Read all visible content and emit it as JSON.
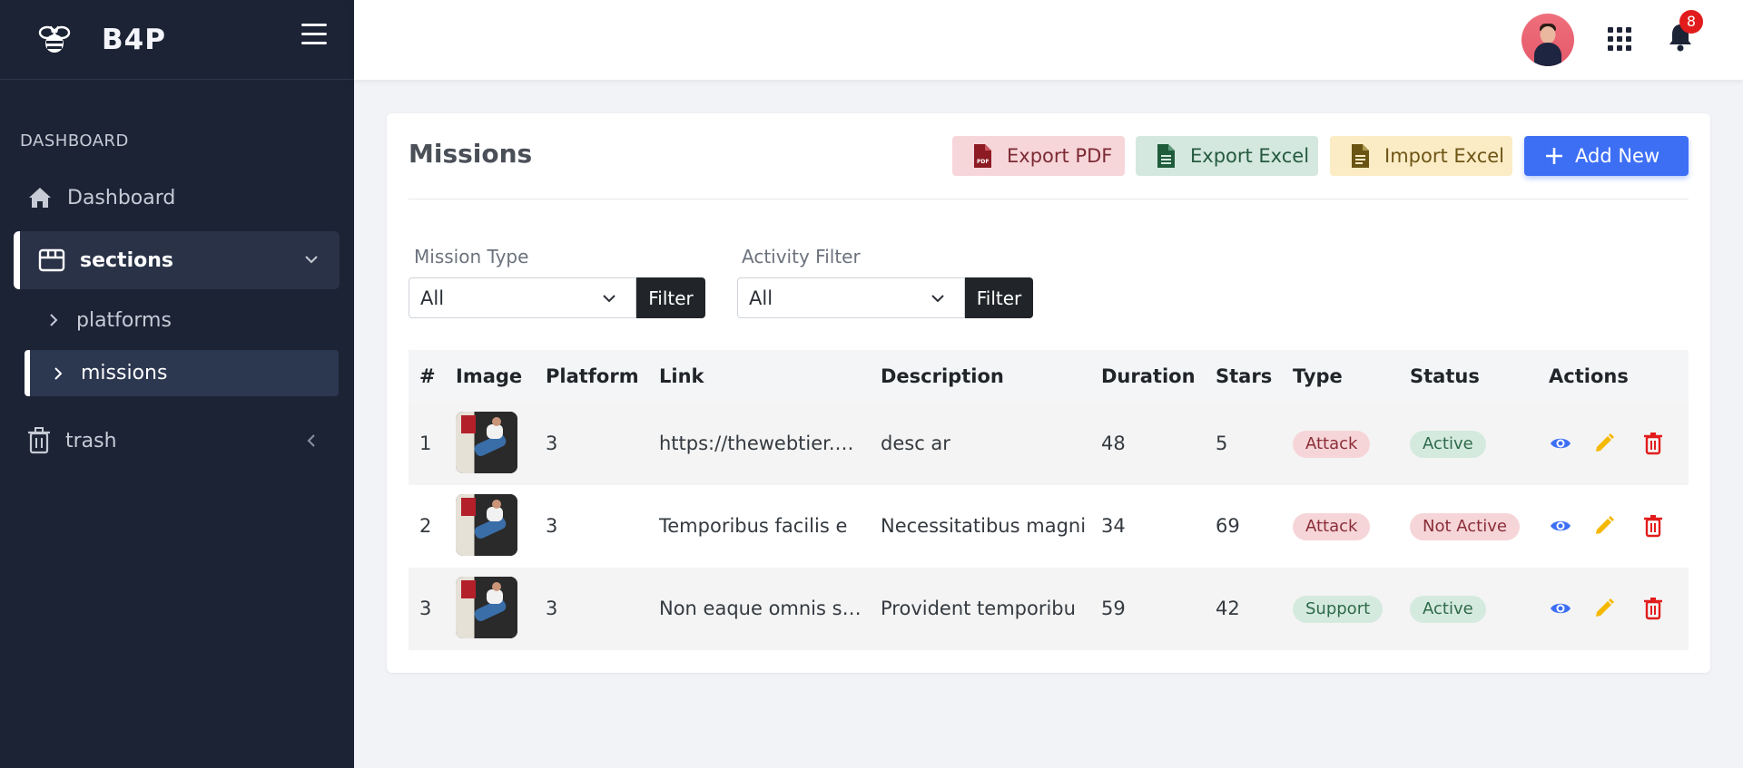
{
  "sidebar": {
    "brand": "B4P",
    "heading": "DASHBOARD",
    "items": {
      "dashboard": "Dashboard",
      "sections": "sections",
      "platforms": "platforms",
      "missions": "missions",
      "trash": "trash"
    }
  },
  "header": {
    "notifications_count": "8"
  },
  "card": {
    "title": "Missions",
    "buttons": {
      "export_pdf": "Export PDF",
      "export_excel": "Export Excel",
      "import_excel": "Import Excel",
      "add_new": "Add New"
    },
    "filters": {
      "mission_type_label": "Mission Type",
      "mission_type_value": "All",
      "activity_label": "Activity Filter",
      "activity_value": "All",
      "filter_button": "Filter"
    },
    "table": {
      "columns": [
        "#",
        "Image",
        "Platform",
        "Link",
        "Description",
        "Duration",
        "Stars",
        "Type",
        "Status",
        "Actions"
      ],
      "rows": [
        {
          "num": "1",
          "platform": "3",
          "link": "https://thewebtier.c...",
          "description": "desc ar",
          "duration": "48",
          "stars": "5",
          "type": "Attack",
          "status": "Active"
        },
        {
          "num": "2",
          "platform": "3",
          "link": "Temporibus facilis e",
          "description": "Necessitatibus magni",
          "duration": "34",
          "stars": "69",
          "type": "Attack",
          "status": "Not Active"
        },
        {
          "num": "3",
          "platform": "3",
          "link": "Non eaque omnis sa...",
          "description": "Provident temporibu",
          "duration": "59",
          "stars": "42",
          "type": "Support",
          "status": "Active"
        }
      ]
    }
  },
  "colors": {
    "sidebar_bg": "#1c2335",
    "primary": "#3d6ff5",
    "danger": "#e21c1c",
    "edit": "#f5b800"
  }
}
